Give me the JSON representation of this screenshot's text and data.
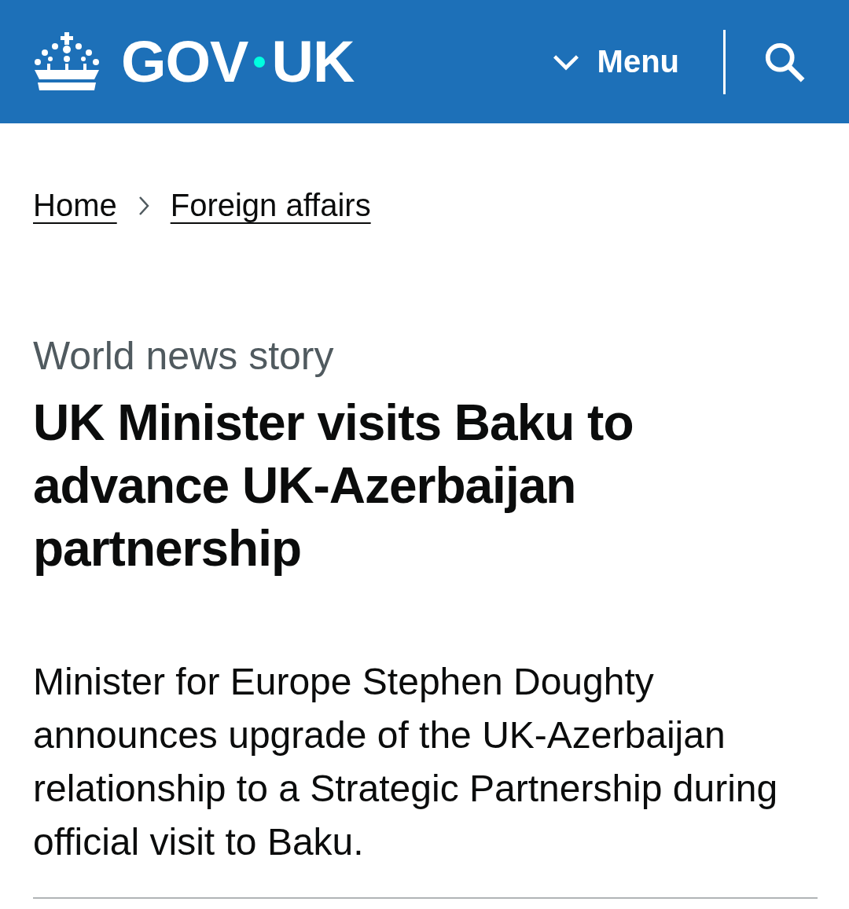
{
  "header": {
    "logo": {
      "part_1": "GOV",
      "part_2": "UK"
    },
    "menu_button": {
      "label": "Menu",
      "expanded": false
    }
  },
  "breadcrumbs": [
    {
      "label": "Home"
    },
    {
      "label": "Foreign affairs"
    }
  ],
  "caption": "World news story",
  "title": "UK Minister visits Baku to advance UK-Azerbaijan partnership",
  "lead": "Minister for Europe Stephen Doughty announces upgrade of the UK-Azerbaijan relationship to a Strategic Partnership during official visit to Baku."
}
